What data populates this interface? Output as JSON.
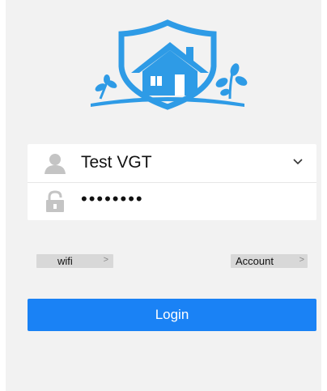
{
  "icons": {
    "logo": "house-shield-logo",
    "user": "user-icon",
    "lock": "lock-icon",
    "dropdown": "chevron-down-icon",
    "link_arrow": "chevron-right-icon"
  },
  "colors": {
    "accent": "#1a82f5",
    "logo": "#2e9be6",
    "background": "#f2f2f2"
  },
  "login_form": {
    "username": "Test VGT",
    "password_masked": "••••••••"
  },
  "links": {
    "wifi_label": "wifi",
    "account_label": "Account",
    "arrow_glyph": ">"
  },
  "actions": {
    "login_label": "Login"
  }
}
